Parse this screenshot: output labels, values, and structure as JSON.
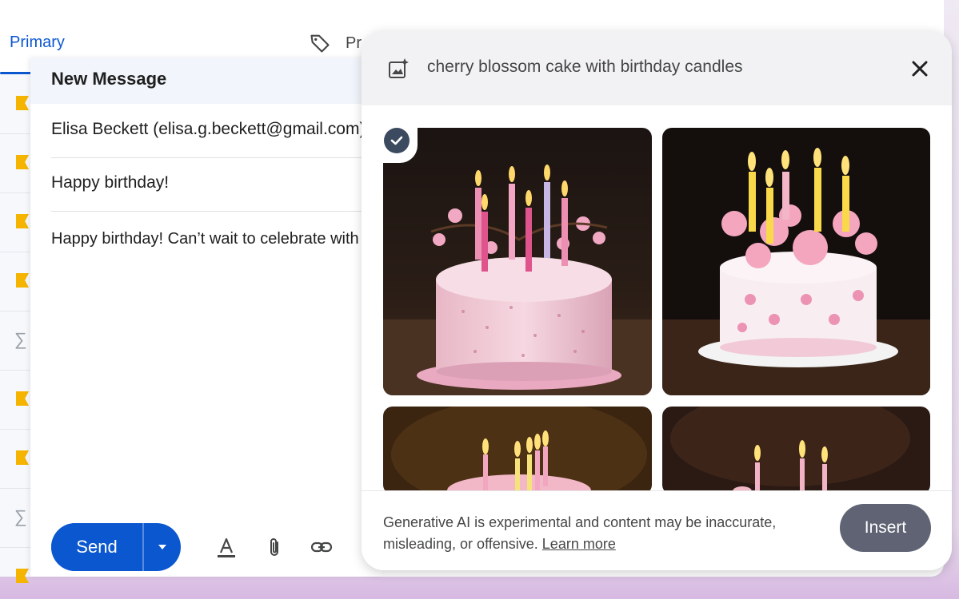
{
  "tabs": {
    "primary_label": "Primary",
    "promotions_label_partial": "Pr"
  },
  "compose": {
    "title": "New Message",
    "recipient": "Elisa Beckett (elisa.g.beckett@gmail.com)",
    "subject": "Happy birthday!",
    "body": "Happy birthday! Can’t wait to celebrate with you",
    "send_label": "Send",
    "toolbar_icons": [
      "text-format-icon",
      "attach-icon",
      "link-icon",
      "emoji-icon"
    ]
  },
  "image_generator": {
    "prompt": "cherry blossom cake with birthday candles",
    "images": [
      {
        "id": 1,
        "selected": true
      },
      {
        "id": 2,
        "selected": false
      },
      {
        "id": 3,
        "selected": false
      },
      {
        "id": 4,
        "selected": false
      }
    ],
    "disclaimer": "Generative AI is experimental and content may be inaccurate, misleading, or offensive.",
    "learn_more_label": "Learn more",
    "insert_label": "Insert"
  },
  "colors": {
    "accent_blue": "#0b57d0",
    "insert_button": "#5f6373",
    "star_marker": "#f4b400"
  }
}
